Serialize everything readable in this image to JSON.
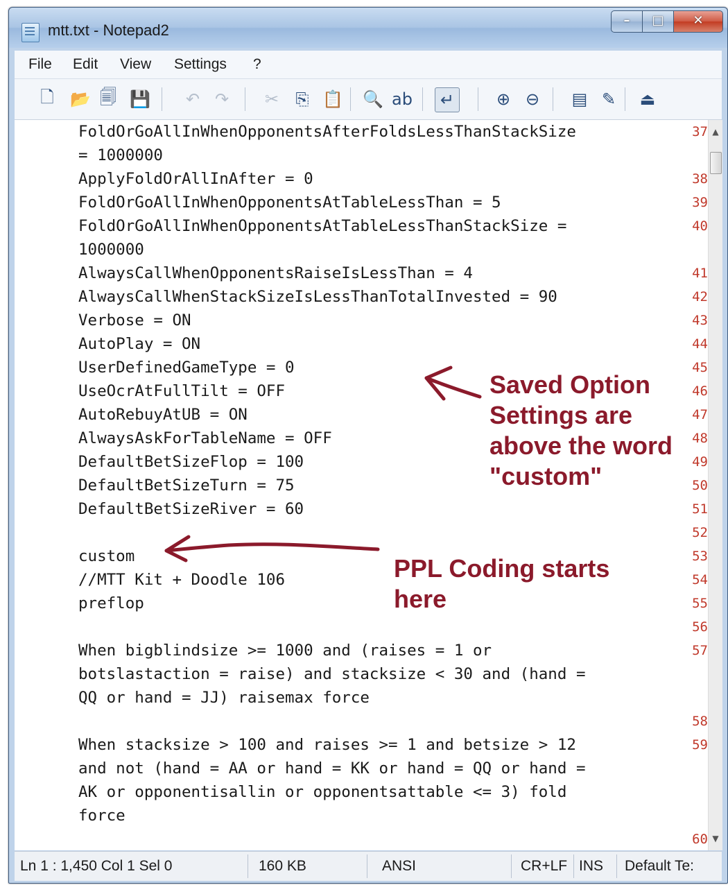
{
  "window": {
    "title": "mtt.txt - Notepad2"
  },
  "menu": [
    "File",
    "Edit",
    "View",
    "Settings",
    "?"
  ],
  "toolbar_icons": [
    {
      "name": "new-icon",
      "glyph": "🗋"
    },
    {
      "name": "open-icon",
      "glyph": "📂"
    },
    {
      "name": "browse-icon",
      "glyph": "🗐"
    },
    {
      "name": "save-icon",
      "glyph": "💾"
    },
    {
      "name": "undo-icon",
      "glyph": "↶"
    },
    {
      "name": "redo-icon",
      "glyph": "↷"
    },
    {
      "name": "cut-icon",
      "glyph": "✂"
    },
    {
      "name": "copy-icon",
      "glyph": "⎘"
    },
    {
      "name": "paste-icon",
      "glyph": "📋"
    },
    {
      "name": "find-icon",
      "glyph": "🔍"
    },
    {
      "name": "replace-icon",
      "glyph": "ab"
    },
    {
      "name": "word-wrap-icon",
      "glyph": "↵"
    },
    {
      "name": "zoom-in-icon",
      "glyph": "⊕"
    },
    {
      "name": "zoom-out-icon",
      "glyph": "⊖"
    },
    {
      "name": "view-scheme-icon",
      "glyph": "▤"
    },
    {
      "name": "customize-scheme-icon",
      "glyph": "✎"
    },
    {
      "name": "exit-icon",
      "glyph": "⏏"
    }
  ],
  "lines": [
    {
      "n": "37",
      "text": "FoldOrGoAllInWhenOpponentsAfterFoldsLessThanStackSize"
    },
    {
      "n": "",
      "text": "= 1000000"
    },
    {
      "n": "38",
      "text": "ApplyFoldOrAllInAfter = 0"
    },
    {
      "n": "39",
      "text": "FoldOrGoAllInWhenOpponentsAtTableLessThan = 5"
    },
    {
      "n": "40",
      "text": "FoldOrGoAllInWhenOpponentsAtTableLessThanStackSize ="
    },
    {
      "n": "",
      "text": "1000000"
    },
    {
      "n": "41",
      "text": "AlwaysCallWhenOpponentsRaiseIsLessThan = 4"
    },
    {
      "n": "42",
      "text": "AlwaysCallWhenStackSizeIsLessThanTotalInvested = 90"
    },
    {
      "n": "43",
      "text": "Verbose = ON"
    },
    {
      "n": "44",
      "text": "AutoPlay = ON"
    },
    {
      "n": "45",
      "text": "UserDefinedGameType = 0"
    },
    {
      "n": "46",
      "text": "UseOcrAtFullTilt = OFF"
    },
    {
      "n": "47",
      "text": "AutoRebuyAtUB = ON"
    },
    {
      "n": "48",
      "text": "AlwaysAskForTableName = OFF"
    },
    {
      "n": "49",
      "text": "DefaultBetSizeFlop = 100"
    },
    {
      "n": "50",
      "text": "DefaultBetSizeTurn = 75"
    },
    {
      "n": "51",
      "text": "DefaultBetSizeRiver = 60"
    },
    {
      "n": "52",
      "text": ""
    },
    {
      "n": "53",
      "text": "custom"
    },
    {
      "n": "54",
      "text": "//MTT Kit + Doodle 106"
    },
    {
      "n": "55",
      "text": "preflop"
    },
    {
      "n": "56",
      "text": ""
    },
    {
      "n": "57",
      "text": "When bigblindsize >= 1000 and (raises = 1 or"
    },
    {
      "n": "",
      "text": "botslastaction = raise) and stacksize < 30 and (hand ="
    },
    {
      "n": "",
      "text": "QQ or hand = JJ) raisemax force"
    },
    {
      "n": "58",
      "text": ""
    },
    {
      "n": "59",
      "text": "When stacksize > 100 and raises >= 1 and betsize > 12"
    },
    {
      "n": "",
      "text": "and not (hand = AA or hand = KK or hand = QQ or hand ="
    },
    {
      "n": "",
      "text": "AK or opponentisallin or opponentsattable <= 3) fold"
    },
    {
      "n": "",
      "text": "force"
    },
    {
      "n": "60",
      "text": ""
    }
  ],
  "status": {
    "position": "Ln 1 : 1,450   Col 1   Sel 0",
    "size": "160 KB",
    "encoding": "ANSI",
    "line_endings": "CR+LF",
    "mode": "INS",
    "scheme": "Default Te:"
  },
  "annotations": {
    "saved_settings": [
      "Saved Option",
      "Settings are",
      "above the word",
      "\"custom\""
    ],
    "ppl_coding": [
      "PPL Coding starts",
      "here"
    ]
  },
  "colors": {
    "annotation": "#8b1a2b",
    "line_numbers": "#c0392b"
  }
}
